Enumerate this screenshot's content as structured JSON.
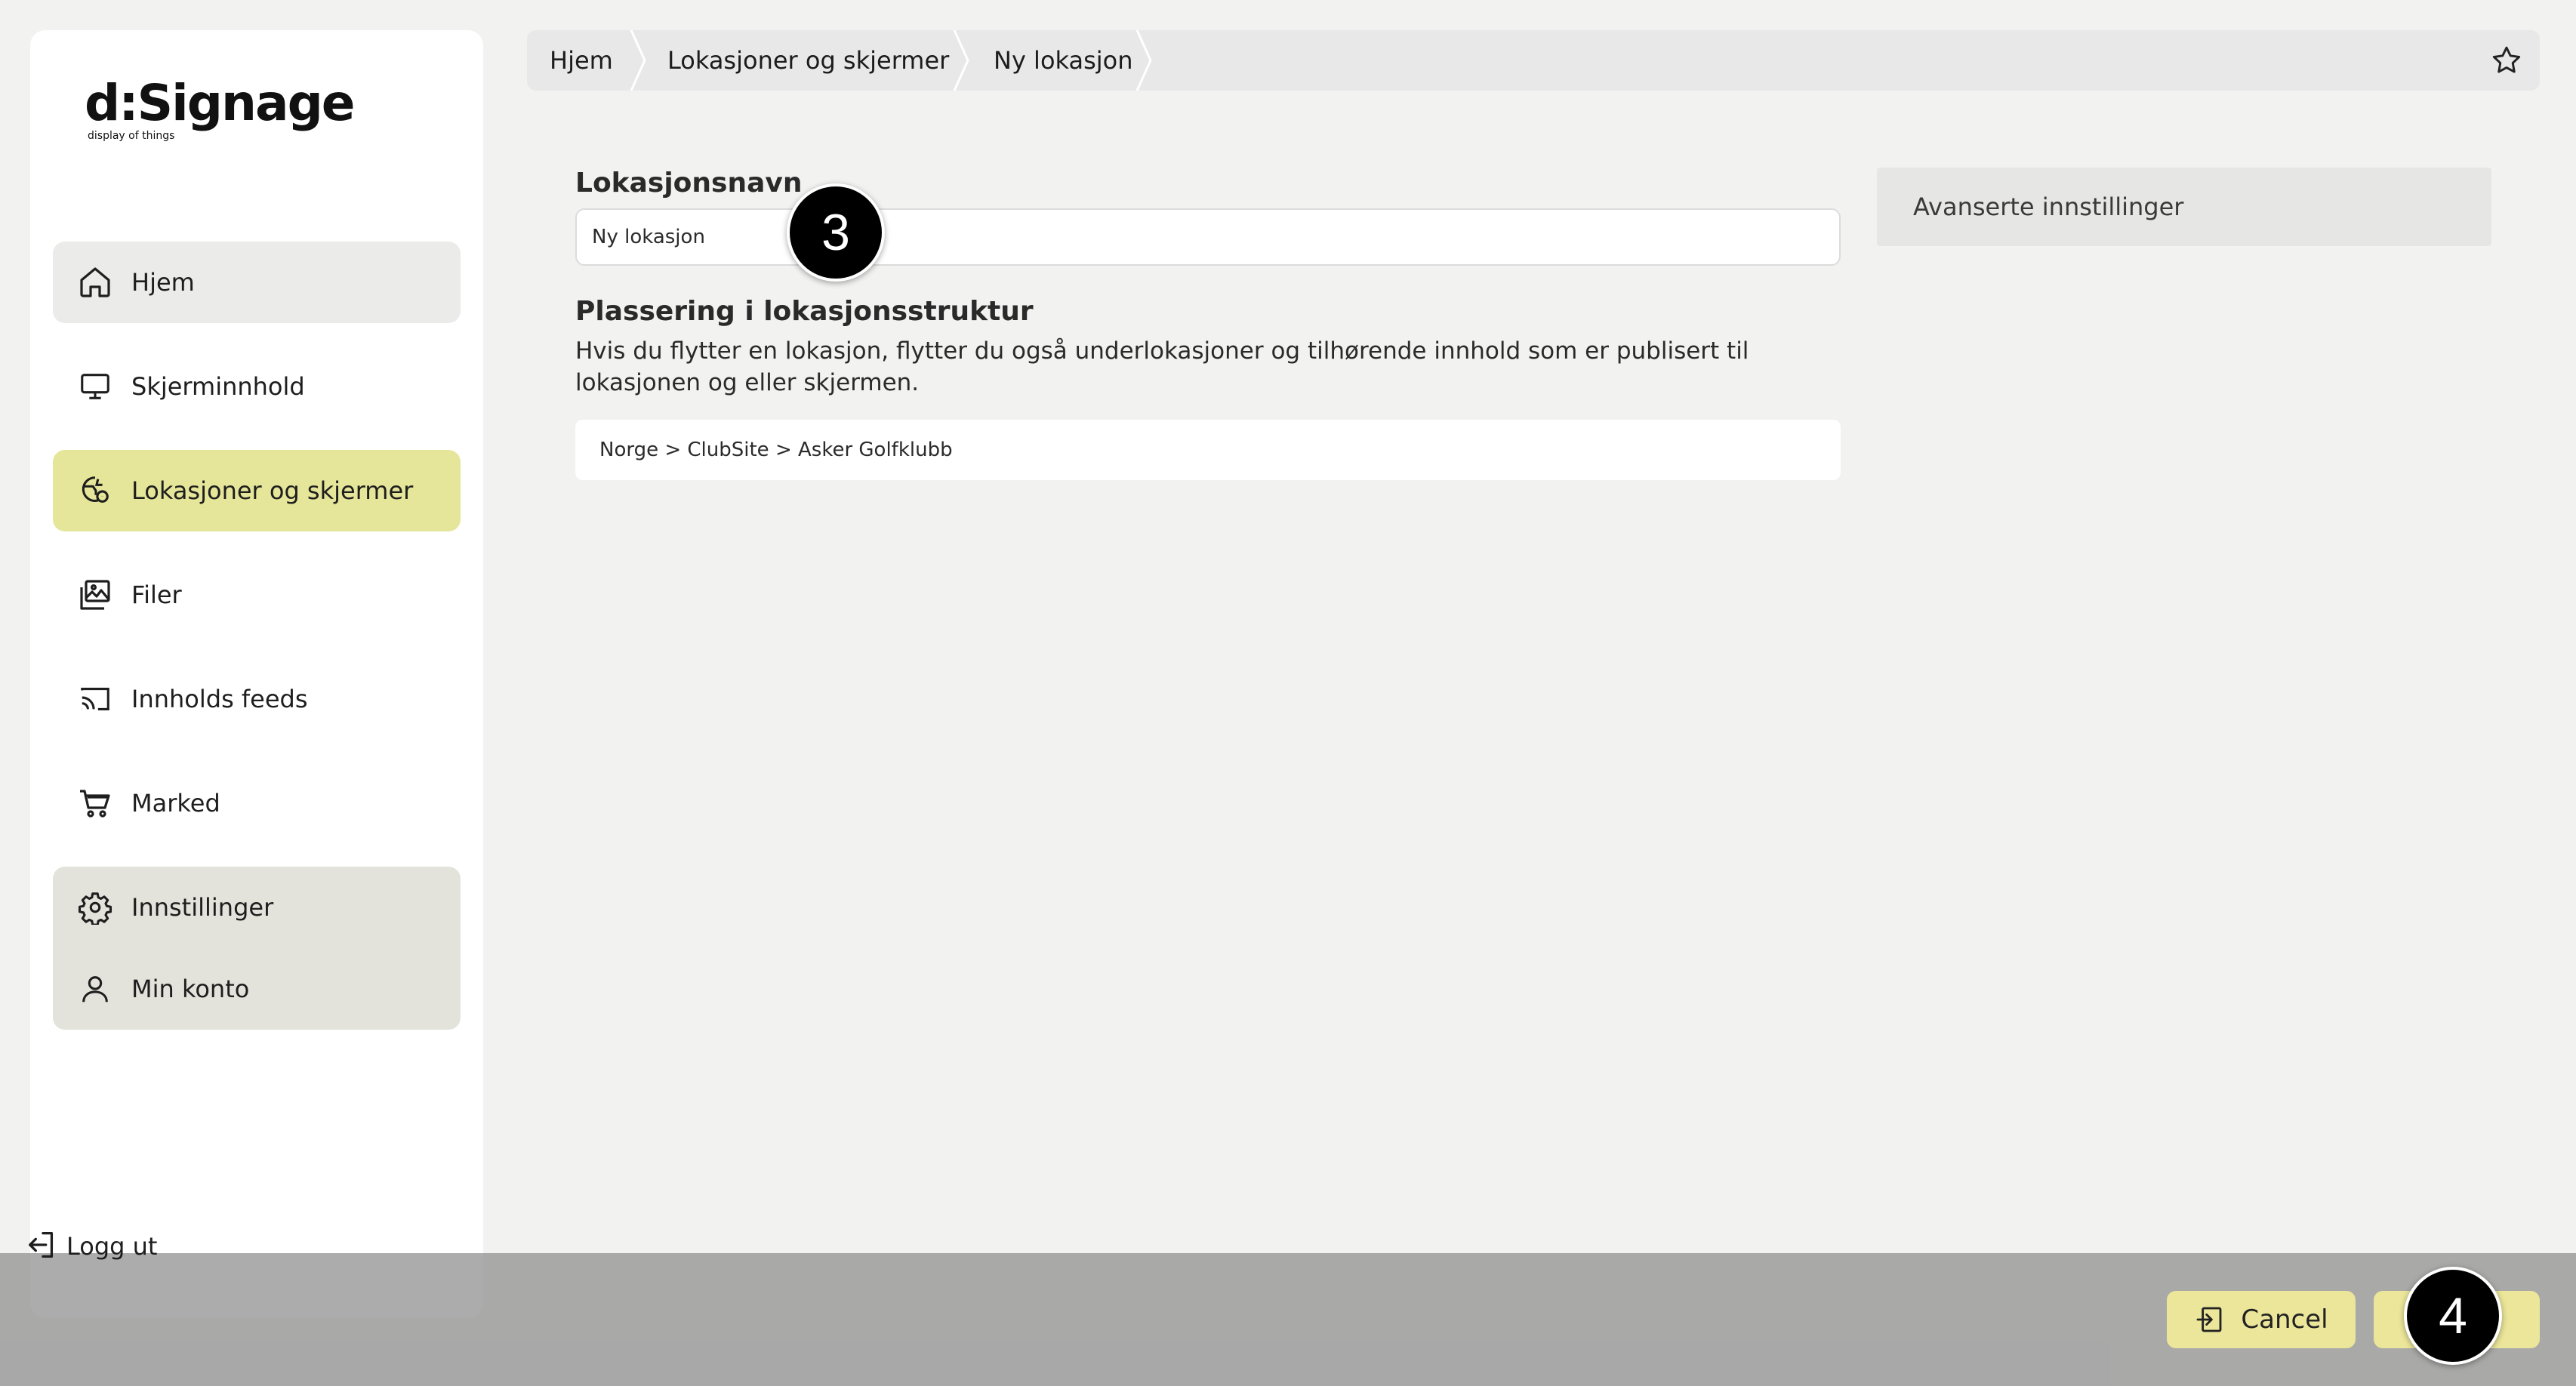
{
  "brand": {
    "name": "d:Signage",
    "tagline": "display of things"
  },
  "sidebar": {
    "items": [
      {
        "label": "Hjem",
        "icon": "home-icon"
      },
      {
        "label": "Skjerminnhold",
        "icon": "monitor-icon"
      },
      {
        "label": "Lokasjoner og skjermer",
        "icon": "location-screen-icon"
      },
      {
        "label": "Filer",
        "icon": "images-icon"
      },
      {
        "label": "Innholds feeds",
        "icon": "cast-icon"
      },
      {
        "label": "Marked",
        "icon": "cart-icon"
      }
    ],
    "settings": [
      {
        "label": "Innstillinger",
        "icon": "gear-icon"
      },
      {
        "label": "Min konto",
        "icon": "user-icon"
      }
    ],
    "logout": "Logg ut"
  },
  "breadcrumb": [
    "Hjem",
    "Lokasjoner og skjermer",
    "Ny lokasjon"
  ],
  "form": {
    "name_label": "Lokasjonsnavn",
    "name_value": "Ny lokasjon",
    "placement_label": "Plassering i lokasjonsstruktur",
    "placement_desc": "Hvis du flytter en lokasjon, flytter du også underlokasjoner og tilhørende innhold som er publisert til lokasjonen og eller skjermen.",
    "placement_path": "Norge > ClubSite > Asker Golfklubb"
  },
  "advanced": "Avanserte innstillinger",
  "actions": {
    "cancel": "Cancel"
  },
  "steps": [
    "3",
    "4"
  ],
  "colors": {
    "active": "#e6e69a",
    "button": "#ebe69a",
    "accent_dark": "#000000"
  }
}
